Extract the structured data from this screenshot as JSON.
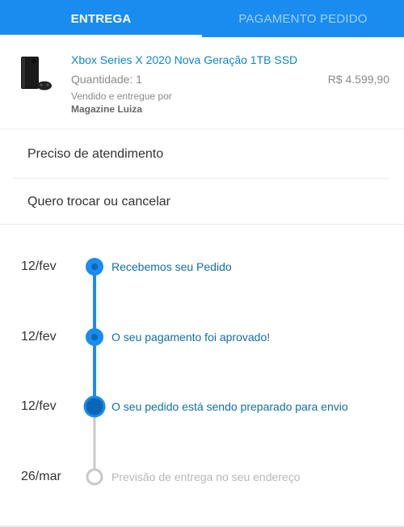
{
  "tabs": {
    "delivery": "ENTREGA",
    "payment": "PAGAMENTO PEDIDO"
  },
  "product": {
    "title": "Xbox Series X 2020 Nova Geração 1TB SSD",
    "quantity": "Quantidade: 1",
    "price": "R$ 4.599,90",
    "sold_by": "Vendido e entregue por",
    "seller": "Magazine Luiza"
  },
  "actions": {
    "support": "Preciso de atendimento",
    "exchange": "Quero trocar ou cancelar"
  },
  "timeline": [
    {
      "date": "12/fev",
      "label": "Recebemos seu Pedido",
      "status": "done"
    },
    {
      "date": "12/fev",
      "label": "O seu pagamento foi aprovado!",
      "status": "done"
    },
    {
      "date": "12/fev",
      "label": "O seu pedido está sendo preparado para envio",
      "status": "current"
    },
    {
      "date": "26/mar",
      "label": "Previsão de entrega no seu endereço",
      "status": "pending"
    }
  ],
  "colors": {
    "brand": "#1a8cf0",
    "done": "#1a8cf0",
    "current": "#0b67b5",
    "pending": "#c8c8c8"
  }
}
